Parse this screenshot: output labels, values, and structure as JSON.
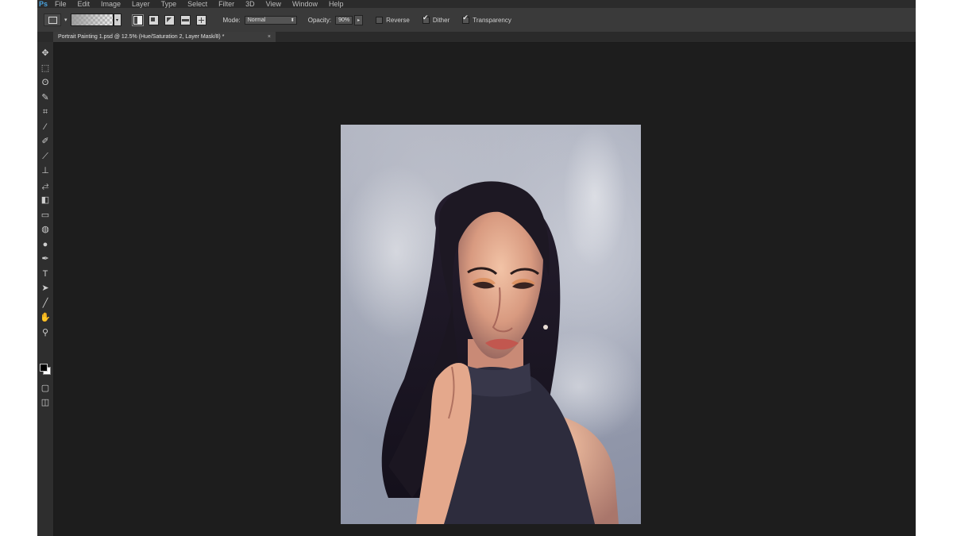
{
  "app": {
    "logo": "Ps",
    "menu": [
      "File",
      "Edit",
      "Image",
      "Layer",
      "Type",
      "Select",
      "Filter",
      "3D",
      "View",
      "Window",
      "Help"
    ]
  },
  "options": {
    "mode_label": "Mode:",
    "mode_value": "Normal",
    "opacity_label": "Opacity:",
    "opacity_value": "90%",
    "reverse_label": "Reverse",
    "reverse_checked": false,
    "dither_label": "Dither",
    "dither_checked": true,
    "transparency_label": "Transparency",
    "transparency_checked": true,
    "gradient_types": [
      "linear",
      "radial",
      "angle",
      "reflected",
      "diamond"
    ]
  },
  "document": {
    "tab_title": "Portrait Painting 1.psd @ 12.5% (Hue/Saturation 2, Layer Mask/8) *",
    "close_glyph": "×"
  },
  "toolbar": {
    "tools": [
      {
        "name": "move-tool-icon",
        "glyph": "✥"
      },
      {
        "name": "marquee-tool-icon",
        "glyph": "⬚"
      },
      {
        "name": "lasso-tool-icon",
        "glyph": "ʘ"
      },
      {
        "name": "quick-select-tool-icon",
        "glyph": "✎"
      },
      {
        "name": "crop-tool-icon",
        "glyph": "⌗"
      },
      {
        "name": "eyedropper-tool-icon",
        "glyph": "⁄"
      },
      {
        "name": "healing-brush-tool-icon",
        "glyph": "✐"
      },
      {
        "name": "brush-tool-icon",
        "glyph": "⟋"
      },
      {
        "name": "clone-stamp-tool-icon",
        "glyph": "⊥"
      },
      {
        "name": "history-brush-tool-icon",
        "glyph": "⥄"
      },
      {
        "name": "eraser-tool-icon",
        "glyph": "◧"
      },
      {
        "name": "gradient-tool-icon",
        "glyph": "▭"
      },
      {
        "name": "blur-tool-icon",
        "glyph": "◍"
      },
      {
        "name": "dodge-tool-icon",
        "glyph": "●"
      },
      {
        "name": "pen-tool-icon",
        "glyph": "✒"
      },
      {
        "name": "type-tool-icon",
        "glyph": "T"
      },
      {
        "name": "path-select-tool-icon",
        "glyph": "➤"
      },
      {
        "name": "line-tool-icon",
        "glyph": "╱"
      },
      {
        "name": "hand-tool-icon",
        "glyph": "✋"
      },
      {
        "name": "zoom-tool-icon",
        "glyph": "⚲"
      }
    ],
    "foreground_color": "#000000",
    "background_color": "#ffffff"
  }
}
